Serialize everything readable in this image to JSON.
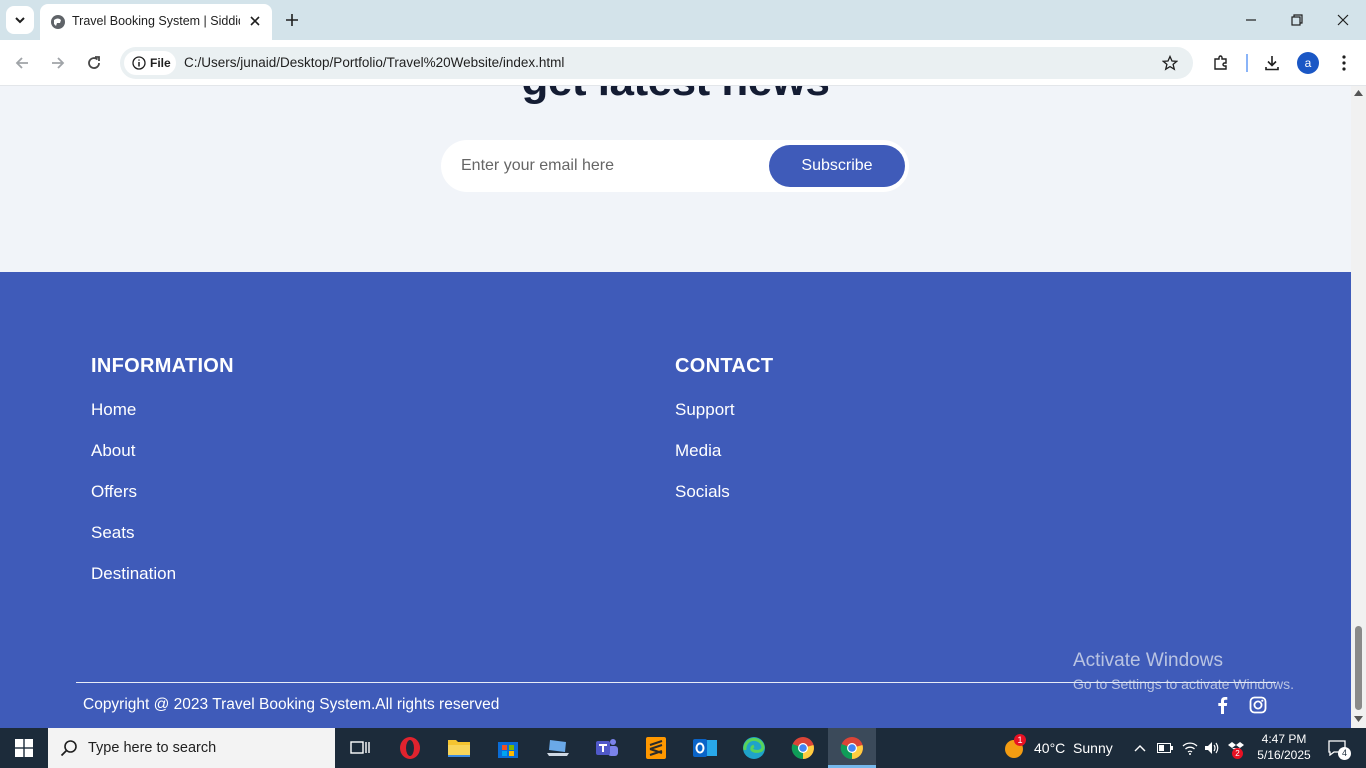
{
  "browser": {
    "tab_title": "Travel Booking System | Siddiqui",
    "file_label": "File",
    "url": "C:/Users/junaid/Desktop/Portfolio/Travel%20Website/index.html",
    "profile_initial": "a"
  },
  "newsletter": {
    "title": "get latest news",
    "email_placeholder": "Enter your email here",
    "subscribe_label": "Subscribe"
  },
  "footer": {
    "information": {
      "title": "INFORMATION",
      "links": [
        "Home",
        "About",
        "Offers",
        "Seats",
        "Destination"
      ]
    },
    "contact": {
      "title": "CONTACT",
      "links": [
        "Support",
        "Media",
        "Socials"
      ]
    },
    "copyright": "Copyright @ 2023 Travel Booking System.All rights reserved",
    "social_icons": [
      "facebook-icon",
      "instagram-icon"
    ]
  },
  "watermark": {
    "line1": "Activate Windows",
    "line2": "Go to Settings to activate Windows."
  },
  "taskbar": {
    "search_placeholder": "Type here to search",
    "weather": "40°C  Sunny",
    "weather_badge": "1",
    "time": "4:47 PM",
    "date": "5/16/2025",
    "notification_count": "4",
    "tray_badge": "2"
  },
  "colors": {
    "brand": "#3f5bb9",
    "page_bg": "#f1f4f9",
    "heading": "#141c33"
  }
}
